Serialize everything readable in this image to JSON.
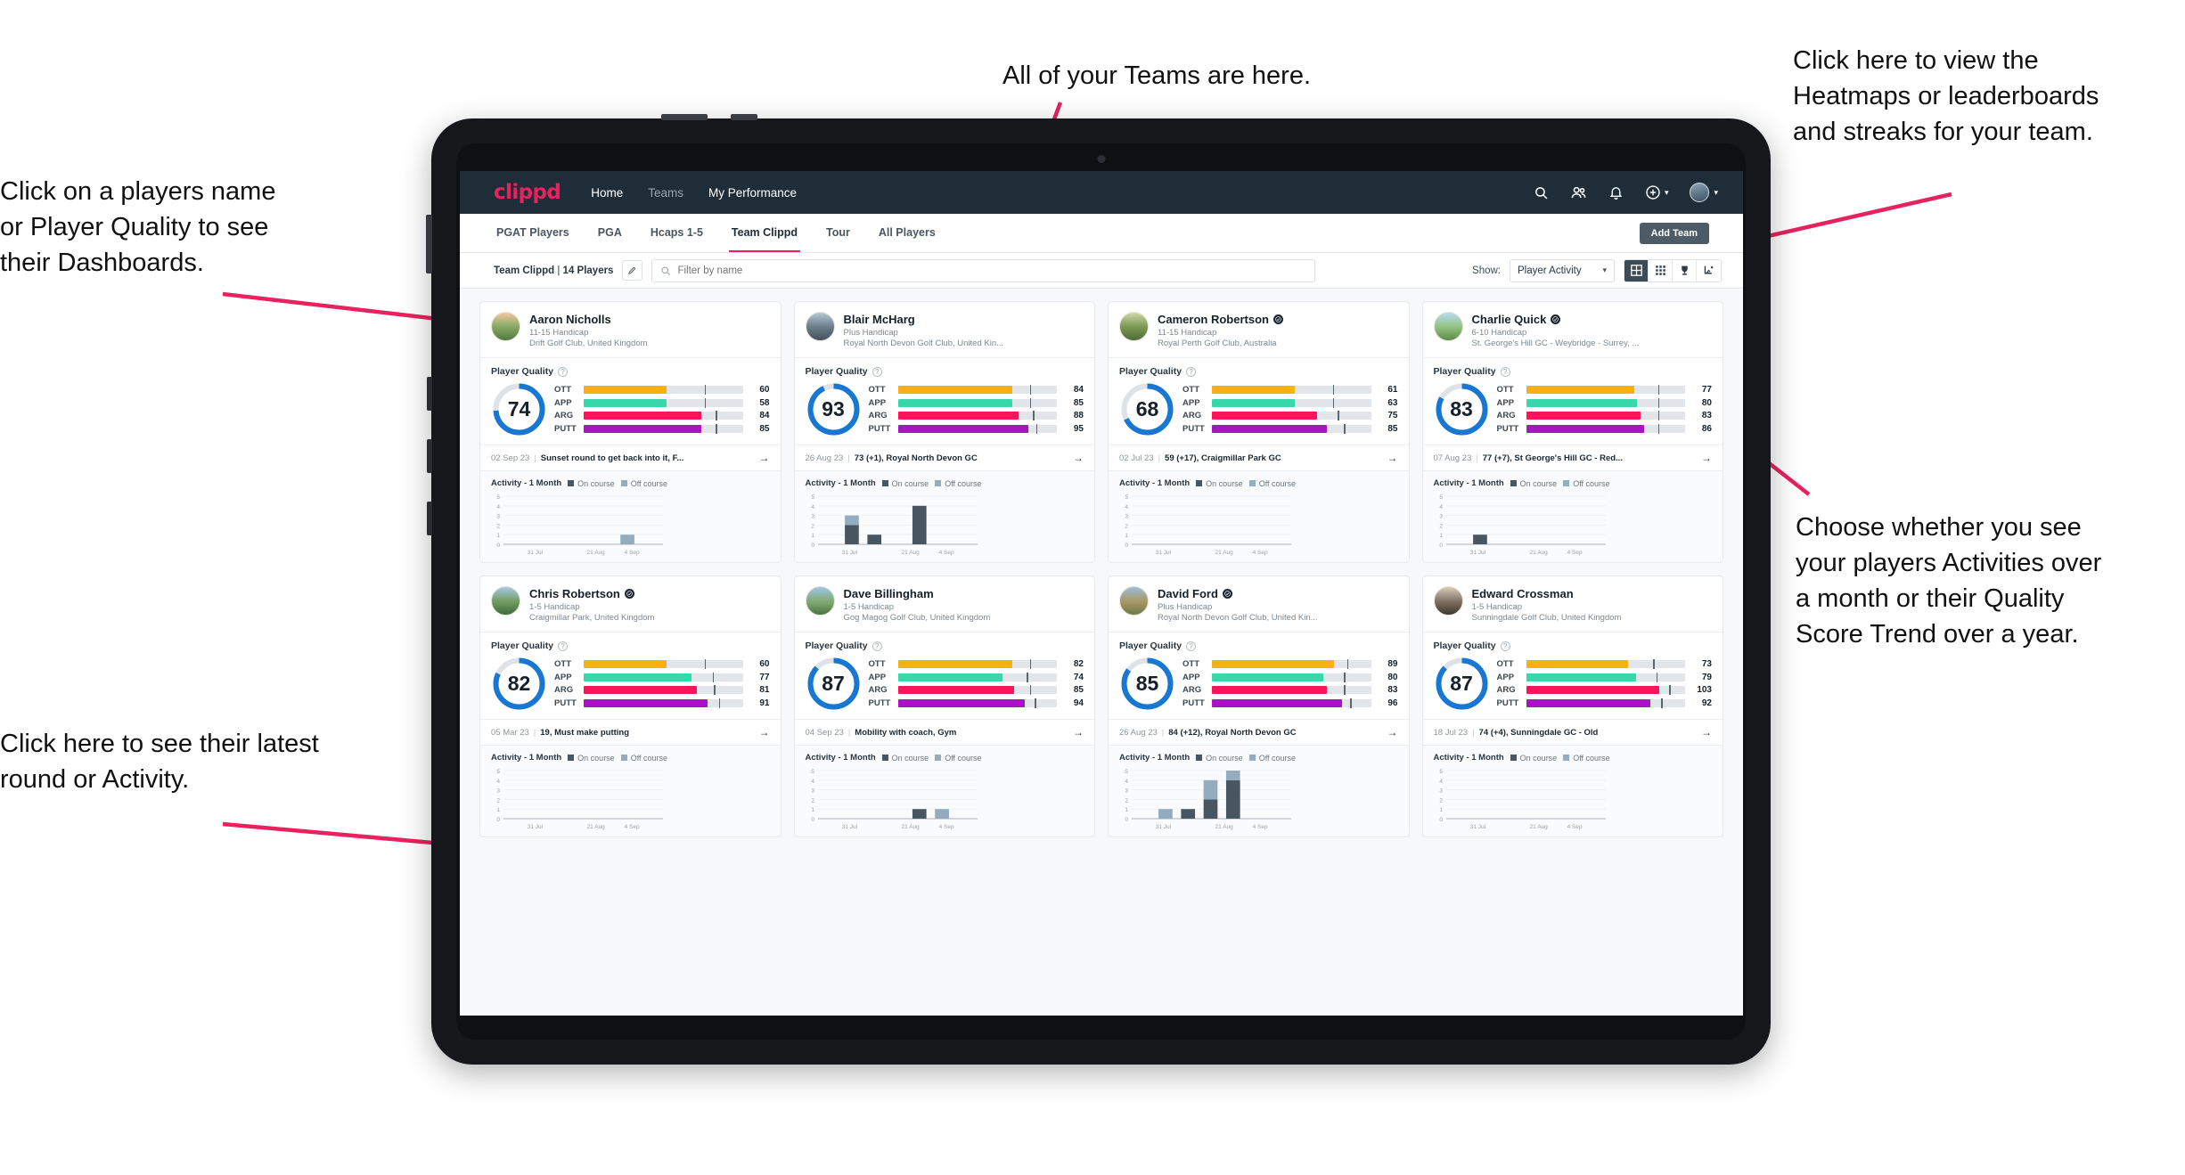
{
  "annotations": [
    {
      "id": "players-name",
      "text": "Click on a players name\nor Player Quality to see\ntheir Dashboards."
    },
    {
      "id": "teams",
      "text": "All of your Teams are here."
    },
    {
      "id": "heatmaps",
      "text": "Click here to view the\nHeatmaps or leaderboards\nand streaks for your team."
    },
    {
      "id": "activity-quality",
      "text": "Choose whether you see\nyour players Activities over\na month or their Quality\nScore Trend over a year."
    },
    {
      "id": "latest-round",
      "text": "Click here to see their latest\nround or Activity."
    }
  ],
  "app": {
    "brand": "clippd",
    "nav": [
      {
        "label": "Home",
        "active": true
      },
      {
        "label": "Teams",
        "active": false
      },
      {
        "label": "My Performance",
        "active": true
      }
    ],
    "icons": {
      "search": "search-icon",
      "people": "people-icon",
      "bell": "bell-icon",
      "plus": "plus-circle-icon",
      "avatar": "user-avatar"
    },
    "subnav": {
      "items": [
        "PGAT Players",
        "PGA",
        "Hcaps 1-5",
        "Team Clippd",
        "Tour",
        "All Players"
      ],
      "active": "Team Clippd",
      "add_team_label": "Add Team"
    },
    "filterbar": {
      "team_name": "Team Clippd",
      "team_count": "14 Players",
      "search_placeholder": "Filter by name",
      "show_label": "Show:",
      "show_value": "Player Activity",
      "view_modes": [
        "grid-large-icon",
        "grid-small-icon",
        "trophy-icon",
        "streak-icon"
      ],
      "active_view": "grid-large-icon"
    },
    "card_labels": {
      "player_quality": "Player Quality",
      "activity": "Activity - 1 Month",
      "legend_on": "On course",
      "legend_off": "Off course",
      "metrics": [
        "OTT",
        "APP",
        "ARG",
        "PUTT"
      ],
      "axis_x": [
        "31 Jul",
        "21 Aug",
        "4 Sep"
      ],
      "axis_y": [
        "5",
        "4",
        "3",
        "2",
        "1",
        "0"
      ]
    },
    "colors": {
      "brand_pink": "#e8225f",
      "nav_dark": "#1f2d38",
      "donut_blue": "#1877d2",
      "ott": "#f9b110",
      "app": "#3ad6ac",
      "arg": "#f5165c",
      "putt": "#aa12c6",
      "on_course": "#475661",
      "off_course": "#93acc0"
    }
  },
  "players": [
    {
      "name": "Aaron Nicholls",
      "verified": false,
      "handicap": "11-15 Handicap",
      "club": "Drift Golf Club, United Kingdom",
      "quality": 74,
      "metrics": [
        {
          "label": "OTT",
          "value": 60,
          "fill": 52,
          "tick": 76
        },
        {
          "label": "APP",
          "value": 58,
          "fill": 52,
          "tick": 76
        },
        {
          "label": "ARG",
          "value": 84,
          "fill": 74,
          "tick": 83
        },
        {
          "label": "PUTT",
          "value": 85,
          "fill": 74,
          "tick": 83
        }
      ],
      "round": {
        "date": "02 Sep 23",
        "desc": "Sunset round to get back into it, F..."
      },
      "activity": {
        "on": [
          0,
          0,
          0,
          0,
          0,
          0,
          0
        ],
        "off": [
          0,
          0,
          0,
          0,
          0,
          1,
          0
        ]
      }
    },
    {
      "name": "Blair McHarg",
      "verified": false,
      "handicap": "Plus Handicap",
      "club": "Royal North Devon Golf Club, United Kin...",
      "quality": 93,
      "metrics": [
        {
          "label": "OTT",
          "value": 84,
          "fill": 72,
          "tick": 83
        },
        {
          "label": "APP",
          "value": 85,
          "fill": 72,
          "tick": 83
        },
        {
          "label": "ARG",
          "value": 88,
          "fill": 76,
          "tick": 85
        },
        {
          "label": "PUTT",
          "value": 95,
          "fill": 82,
          "tick": 87
        }
      ],
      "round": {
        "date": "26 Aug 23",
        "desc": "73 (+1), Royal North Devon GC"
      },
      "activity": {
        "on": [
          0,
          2,
          1,
          0,
          0,
          0,
          0
        ],
        "off": [
          0,
          1,
          0,
          0,
          0,
          0,
          0
        ],
        "on2": [
          0,
          0,
          0,
          0,
          4,
          0,
          0
        ]
      }
    },
    {
      "name": "Cameron Robertson",
      "verified": true,
      "handicap": "11-15 Handicap",
      "club": "Royal Perth Golf Club, Australia",
      "quality": 68,
      "metrics": [
        {
          "label": "OTT",
          "value": 61,
          "fill": 52,
          "tick": 76
        },
        {
          "label": "APP",
          "value": 63,
          "fill": 52,
          "tick": 76
        },
        {
          "label": "ARG",
          "value": 75,
          "fill": 66,
          "tick": 79
        },
        {
          "label": "PUTT",
          "value": 85,
          "fill": 72,
          "tick": 83
        }
      ],
      "round": {
        "date": "02 Jul 23",
        "desc": "59 (+17), Craigmillar Park GC"
      },
      "activity": {
        "on": [
          0,
          0,
          0,
          0,
          0,
          0,
          0
        ],
        "off": [
          0,
          0,
          0,
          0,
          0,
          0,
          0
        ]
      }
    },
    {
      "name": "Charlie Quick",
      "verified": true,
      "handicap": "6-10 Handicap",
      "club": "St. George's Hill GC - Weybridge - Surrey, ...",
      "quality": 83,
      "metrics": [
        {
          "label": "OTT",
          "value": 77,
          "fill": 68,
          "tick": 83
        },
        {
          "label": "APP",
          "value": 80,
          "fill": 70,
          "tick": 83
        },
        {
          "label": "ARG",
          "value": 83,
          "fill": 72,
          "tick": 83
        },
        {
          "label": "PUTT",
          "value": 86,
          "fill": 74,
          "tick": 83
        }
      ],
      "round": {
        "date": "07 Aug 23",
        "desc": "77 (+7), St George's Hill GC - Red..."
      },
      "activity": {
        "on": [
          0,
          1,
          0,
          0,
          0,
          0,
          0
        ],
        "off": [
          0,
          0,
          0,
          0,
          0,
          0,
          0
        ]
      }
    },
    {
      "name": "Chris Robertson",
      "verified": true,
      "handicap": "1-5 Handicap",
      "club": "Craigmillar Park, United Kingdom",
      "quality": 82,
      "metrics": [
        {
          "label": "OTT",
          "value": 60,
          "fill": 52,
          "tick": 76
        },
        {
          "label": "APP",
          "value": 77,
          "fill": 68,
          "tick": 81
        },
        {
          "label": "ARG",
          "value": 81,
          "fill": 71,
          "tick": 82
        },
        {
          "label": "PUTT",
          "value": 91,
          "fill": 78,
          "tick": 85
        }
      ],
      "round": {
        "date": "05 Mar 23",
        "desc": "19, Must make putting"
      },
      "activity": {
        "on": [
          0,
          0,
          0,
          0,
          0,
          0,
          0
        ],
        "off": [
          0,
          0,
          0,
          0,
          0,
          0,
          0
        ]
      }
    },
    {
      "name": "Dave Billingham",
      "verified": false,
      "handicap": "1-5 Handicap",
      "club": "Gog Magog Golf Club, United Kingdom",
      "quality": 87,
      "metrics": [
        {
          "label": "OTT",
          "value": 82,
          "fill": 72,
          "tick": 83
        },
        {
          "label": "APP",
          "value": 74,
          "fill": 66,
          "tick": 81
        },
        {
          "label": "ARG",
          "value": 85,
          "fill": 73,
          "tick": 83
        },
        {
          "label": "PUTT",
          "value": 94,
          "fill": 80,
          "tick": 86
        }
      ],
      "round": {
        "date": "04 Sep 23",
        "desc": "Mobility with coach, Gym"
      },
      "activity": {
        "on": [
          0,
          0,
          0,
          0,
          1,
          0,
          0
        ],
        "off": [
          0,
          0,
          0,
          0,
          0,
          1,
          0
        ]
      }
    },
    {
      "name": "David Ford",
      "verified": true,
      "handicap": "Plus Handicap",
      "club": "Royal North Devon Golf Club, United Kin...",
      "quality": 85,
      "metrics": [
        {
          "label": "OTT",
          "value": 89,
          "fill": 77,
          "tick": 85
        },
        {
          "label": "APP",
          "value": 80,
          "fill": 70,
          "tick": 83
        },
        {
          "label": "ARG",
          "value": 83,
          "fill": 72,
          "tick": 83
        },
        {
          "label": "PUTT",
          "value": 96,
          "fill": 82,
          "tick": 87
        }
      ],
      "round": {
        "date": "26 Aug 23",
        "desc": "84 (+12), Royal North Devon GC"
      },
      "activity": {
        "on": [
          0,
          0,
          1,
          2,
          4,
          0,
          0
        ],
        "off": [
          0,
          1,
          0,
          2,
          1,
          0,
          0
        ]
      }
    },
    {
      "name": "Edward Crossman",
      "verified": false,
      "handicap": "1-5 Handicap",
      "club": "Sunningdale Golf Club, United Kingdom",
      "quality": 87,
      "metrics": [
        {
          "label": "OTT",
          "value": 73,
          "fill": 64,
          "tick": 80
        },
        {
          "label": "APP",
          "value": 79,
          "fill": 69,
          "tick": 82
        },
        {
          "label": "ARG",
          "value": 103,
          "fill": 84,
          "tick": 90
        },
        {
          "label": "PUTT",
          "value": 92,
          "fill": 78,
          "tick": 85
        }
      ],
      "round": {
        "date": "18 Jul 23",
        "desc": "74 (+4), Sunningdale GC - Old"
      },
      "activity": {
        "on": [
          0,
          0,
          0,
          0,
          0,
          0,
          0
        ],
        "off": [
          0,
          0,
          0,
          0,
          0,
          0,
          0
        ]
      }
    }
  ],
  "chart_data": {
    "type": "bar",
    "title": "Activity - 1 Month",
    "xlabel": "",
    "ylabel": "",
    "ylim": [
      0,
      5
    ],
    "categories": [
      "31 Jul",
      "21 Aug",
      "4 Sep"
    ],
    "legend": [
      "On course",
      "Off course"
    ],
    "legend_position": "top",
    "grid": true,
    "stacked": true,
    "charts": [
      {
        "player": "Aaron Nicholls",
        "bars": [
          {
            "x": 5,
            "on": 0,
            "off": 1
          }
        ]
      },
      {
        "player": "Blair McHarg",
        "bars": [
          {
            "x": 1,
            "on": 2,
            "off": 1
          },
          {
            "x": 2,
            "on": 1,
            "off": 0
          },
          {
            "x": 4,
            "on": 4,
            "off": 0
          }
        ]
      },
      {
        "player": "Cameron Robertson",
        "bars": []
      },
      {
        "player": "Charlie Quick",
        "bars": [
          {
            "x": 1,
            "on": 1,
            "off": 0
          }
        ]
      },
      {
        "player": "Chris Robertson",
        "bars": []
      },
      {
        "player": "Dave Billingham",
        "bars": [
          {
            "x": 4,
            "on": 1,
            "off": 0
          },
          {
            "x": 5,
            "on": 0,
            "off": 1
          }
        ]
      },
      {
        "player": "David Ford",
        "bars": [
          {
            "x": 1,
            "on": 0,
            "off": 1
          },
          {
            "x": 2,
            "on": 1,
            "off": 0
          },
          {
            "x": 3,
            "on": 2,
            "off": 2
          },
          {
            "x": 4,
            "on": 4,
            "off": 1
          }
        ]
      },
      {
        "player": "Edward Crossman",
        "bars": []
      }
    ]
  }
}
